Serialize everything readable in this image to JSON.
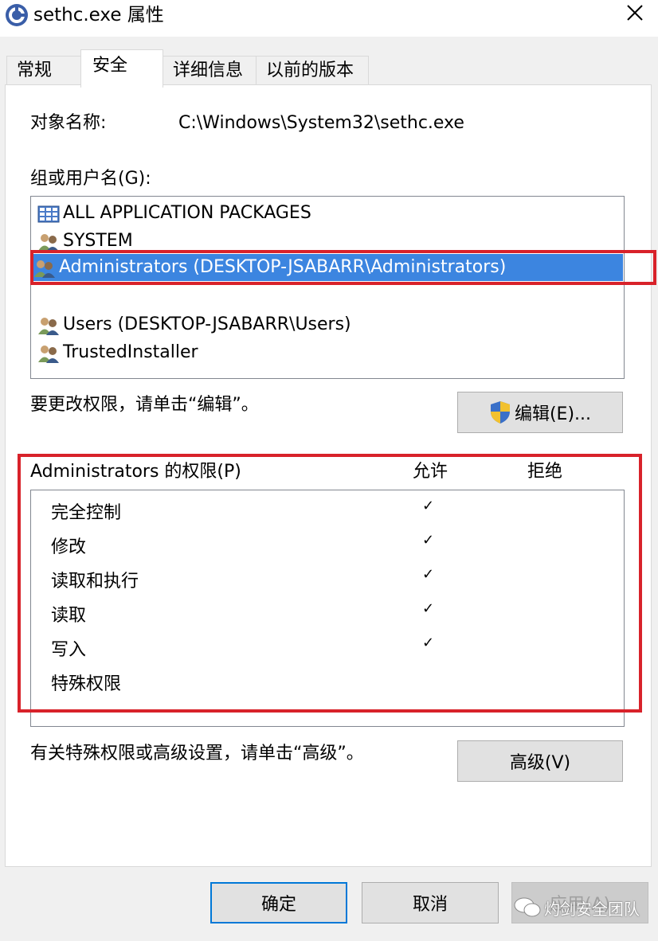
{
  "window": {
    "title": "sethc.exe 属性",
    "close_symbol": "✕"
  },
  "tabs": [
    {
      "label": "常规",
      "active": false
    },
    {
      "label": "安全",
      "active": true
    },
    {
      "label": "详细信息",
      "active": false
    },
    {
      "label": "以前的版本",
      "active": false
    }
  ],
  "object": {
    "label": "对象名称:",
    "value": "C:\\Windows\\System32\\sethc.exe"
  },
  "groups": {
    "label": "组或用户名(G):",
    "items": [
      {
        "name": "ALL APPLICATION PACKAGES",
        "icon": "packages-icon",
        "selected": false
      },
      {
        "name": "SYSTEM",
        "icon": "users-icon",
        "selected": false
      },
      {
        "name": "Administrators (DESKTOP-JSABARR\\Administrators)",
        "icon": "users-icon",
        "selected": true
      },
      {
        "name": "Users (DESKTOP-JSABARR\\Users)",
        "icon": "users-icon",
        "selected": false
      },
      {
        "name": "TrustedInstaller",
        "icon": "users-icon",
        "selected": false
      }
    ]
  },
  "edit": {
    "hint": "要更改权限，请单击“编辑”。",
    "button_label": "编辑(E)..."
  },
  "permissions": {
    "header": "Administrators 的权限(P)",
    "allow_header": "允许",
    "deny_header": "拒绝",
    "check_symbol": "✓",
    "rows": [
      {
        "name": "完全控制",
        "allow": true,
        "deny": false
      },
      {
        "name": "修改",
        "allow": true,
        "deny": false
      },
      {
        "name": "读取和执行",
        "allow": true,
        "deny": false
      },
      {
        "name": "读取",
        "allow": true,
        "deny": false
      },
      {
        "name": "写入",
        "allow": true,
        "deny": false
      },
      {
        "name": "特殊权限",
        "allow": false,
        "deny": false
      }
    ]
  },
  "advanced": {
    "hint": "有关特殊权限或高级设置，请单击“高级”。",
    "button_label": "高级(V)"
  },
  "footer": {
    "ok_label": "确定",
    "cancel_label": "取消",
    "apply_label": "应用(A)"
  },
  "watermark": {
    "text": "灼剑安全团队"
  },
  "colors": {
    "selection": "#3c85e0",
    "highlight": "#d8222a",
    "focus_border": "#0078d7"
  }
}
